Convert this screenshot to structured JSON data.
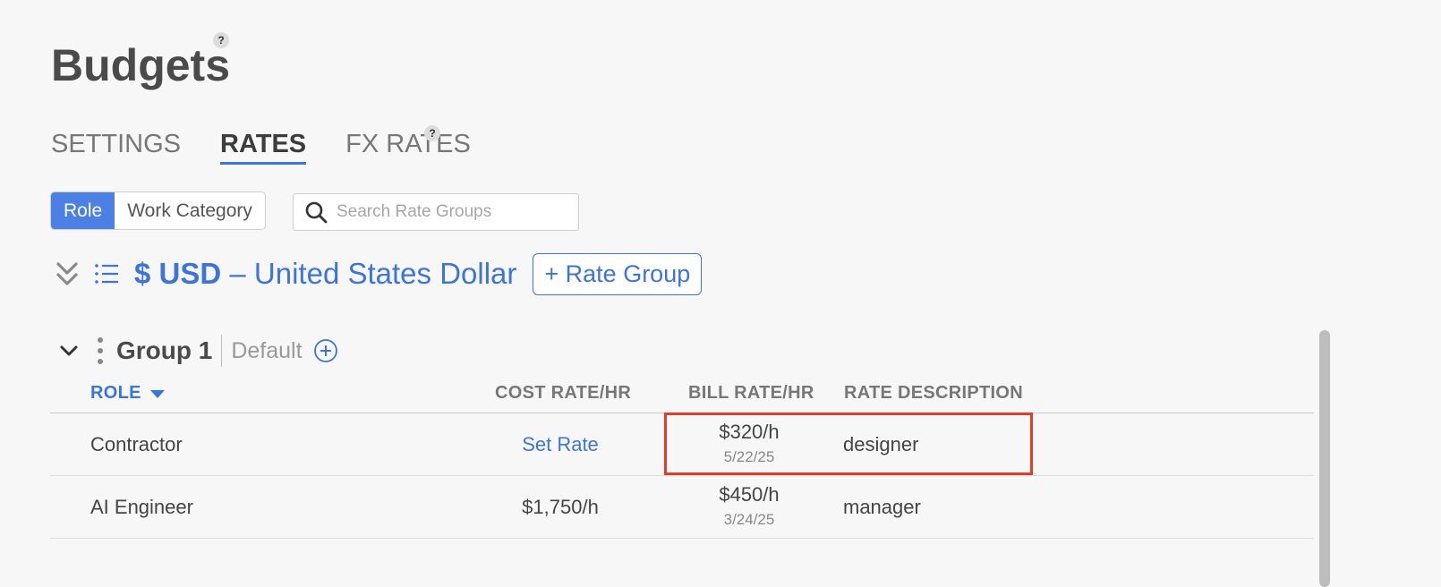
{
  "page": {
    "title": "Budgets",
    "help_glyph": "?"
  },
  "tabs": [
    {
      "label": "SETTINGS",
      "active": false
    },
    {
      "label": "RATES",
      "active": true
    },
    {
      "label": "FX RATES",
      "active": false
    }
  ],
  "toggle": {
    "options": [
      "Role",
      "Work Category"
    ],
    "selected": "Role"
  },
  "search": {
    "placeholder": "Search Rate Groups",
    "value": ""
  },
  "currency": {
    "code": "$ USD",
    "separator": "–",
    "name": "United States Dollar",
    "add_button": "+ Rate Group"
  },
  "group": {
    "name": "Group 1",
    "default_label": "Default"
  },
  "table": {
    "columns": {
      "role": "ROLE",
      "cost": "COST RATE/HR",
      "bill": "BILL RATE/HR",
      "description": "RATE DESCRIPTION"
    },
    "rows": [
      {
        "role": "Contractor",
        "cost": "Set Rate",
        "bill": "$320/h",
        "bill_date": "5/22/25",
        "description": "designer"
      },
      {
        "role": "AI Engineer",
        "cost": "$1,750/h",
        "bill": "$450/h",
        "bill_date": "3/24/25",
        "description": "manager"
      }
    ]
  },
  "colors": {
    "accent": "#3d74d9",
    "toggle_active": "#4d80e4",
    "highlight": "#e13d29",
    "background": "#f7f7f7"
  }
}
